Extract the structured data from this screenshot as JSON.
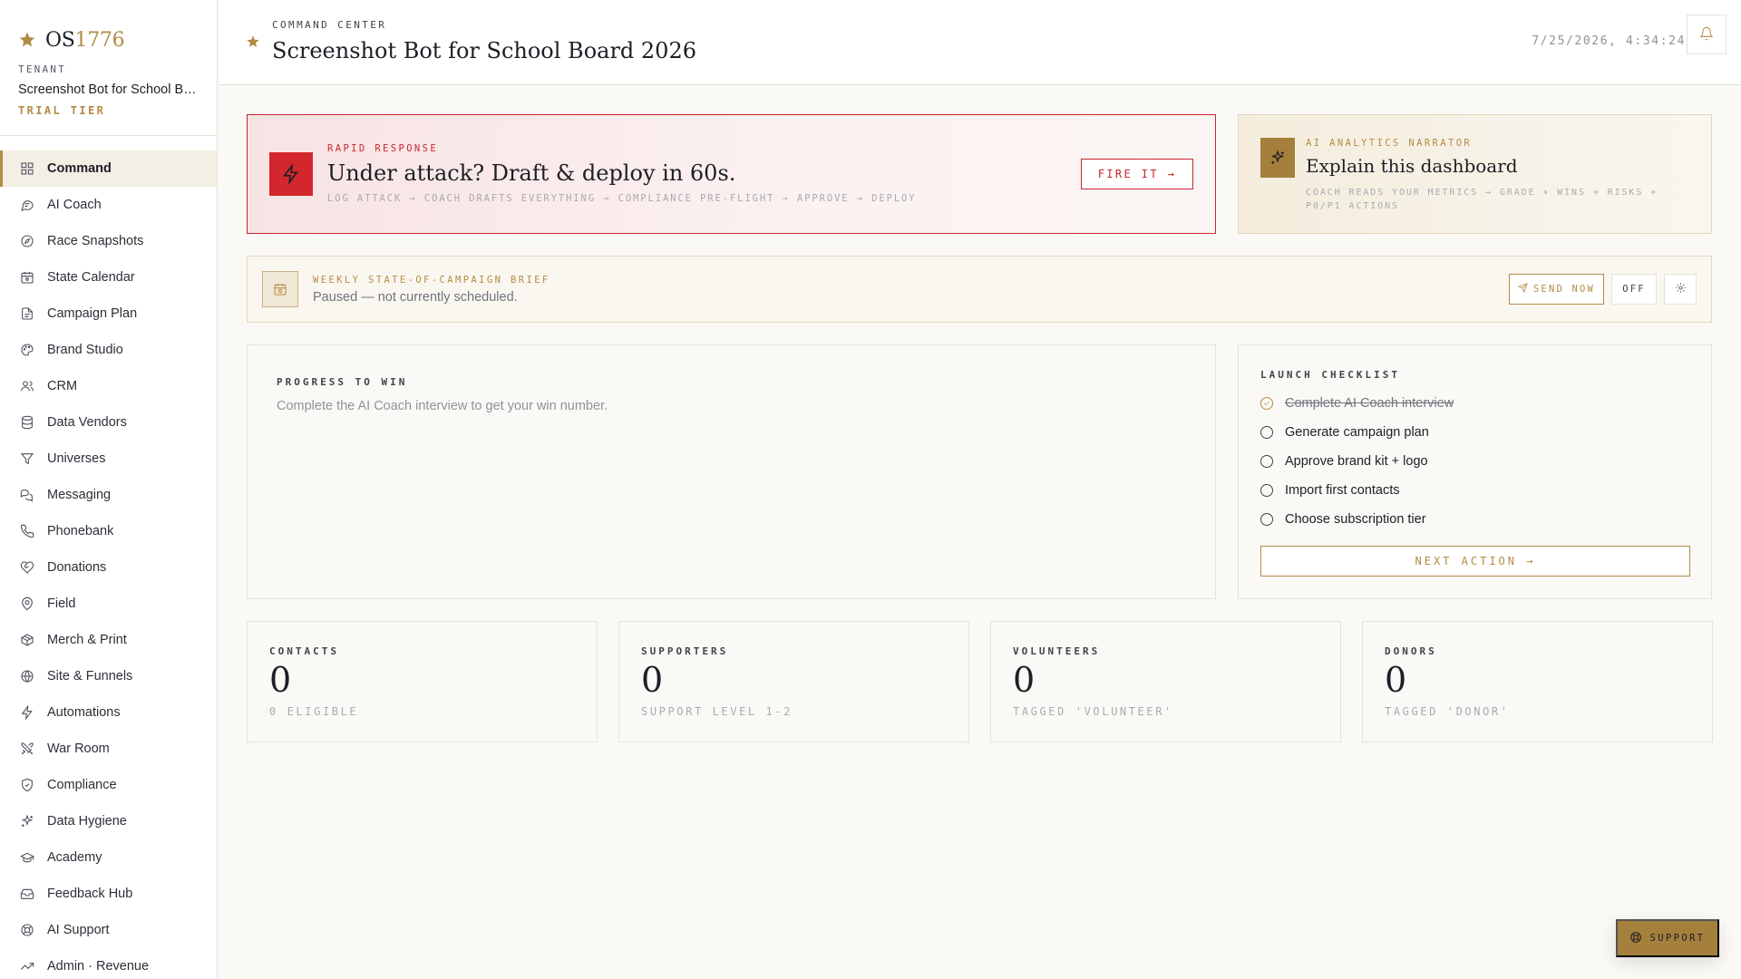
{
  "brand": {
    "name_part1": "OS",
    "name_part2": "1776"
  },
  "tenant": {
    "label": "TENANT",
    "name": "Screenshot Bot for School Board 2026",
    "tier": "TRIAL TIER"
  },
  "nav": [
    {
      "label": "Command",
      "icon": "grid-icon",
      "active": true
    },
    {
      "label": "AI Coach",
      "icon": "chat-icon"
    },
    {
      "label": "Race Snapshots",
      "icon": "compass-icon"
    },
    {
      "label": "State Calendar",
      "icon": "calendar-icon"
    },
    {
      "label": "Campaign Plan",
      "icon": "document-icon"
    },
    {
      "label": "Brand Studio",
      "icon": "palette-icon"
    },
    {
      "label": "CRM",
      "icon": "users-icon"
    },
    {
      "label": "Data Vendors",
      "icon": "database-icon"
    },
    {
      "label": "Universes",
      "icon": "filter-icon"
    },
    {
      "label": "Messaging",
      "icon": "messages-icon"
    },
    {
      "label": "Phonebank",
      "icon": "phone-icon"
    },
    {
      "label": "Donations",
      "icon": "heart-hand-icon"
    },
    {
      "label": "Field",
      "icon": "map-pin-icon"
    },
    {
      "label": "Merch & Print",
      "icon": "package-icon"
    },
    {
      "label": "Site & Funnels",
      "icon": "globe-icon"
    },
    {
      "label": "Automations",
      "icon": "bolt-icon"
    },
    {
      "label": "War Room",
      "icon": "swords-icon"
    },
    {
      "label": "Compliance",
      "icon": "shield-check-icon"
    },
    {
      "label": "Data Hygiene",
      "icon": "sparkles-icon"
    },
    {
      "label": "Academy",
      "icon": "graduation-cap-icon"
    },
    {
      "label": "Feedback Hub",
      "icon": "inbox-icon"
    },
    {
      "label": "AI Support",
      "icon": "life-buoy-icon"
    },
    {
      "label": "Admin · Revenue",
      "icon": "trending-up-icon"
    }
  ],
  "header": {
    "label": "COMMAND CENTER",
    "title": "Screenshot Bot for School Board 2026",
    "clock": "7/25/2026, 4:34:24"
  },
  "rapid": {
    "label": "RAPID RESPONSE",
    "title": "Under attack? Draft & deploy in 60s.",
    "subtitle": "LOG ATTACK → COACH DRAFTS EVERYTHING → COMPLIANCE PRE-FLIGHT → APPROVE → DEPLOY",
    "button": "FIRE IT →"
  },
  "narrator": {
    "label": "AI ANALYTICS NARRATOR",
    "title": "Explain this dashboard",
    "subtitle": "COACH READS YOUR METRICS → GRADE + WINS + RISKS + P0/P1 ACTIONS"
  },
  "weekly": {
    "label": "WEEKLY STATE-OF-CAMPAIGN BRIEF",
    "status": "Paused — not currently scheduled.",
    "send_button": "SEND NOW",
    "toggle_button": "OFF"
  },
  "progress": {
    "label": "PROGRESS TO WIN",
    "text": "Complete the AI Coach interview to get your win number."
  },
  "checklist": {
    "label": "LAUNCH CHECKLIST",
    "items": [
      {
        "label": "Complete AI Coach interview",
        "done": true
      },
      {
        "label": "Generate campaign plan",
        "done": false
      },
      {
        "label": "Approve brand kit + logo",
        "done": false
      },
      {
        "label": "Import first contacts",
        "done": false
      },
      {
        "label": "Choose subscription tier",
        "done": false
      }
    ],
    "next_button": "NEXT ACTION →"
  },
  "stats": [
    {
      "label": "CONTACTS",
      "value": "0",
      "sub": "0 ELIGIBLE"
    },
    {
      "label": "SUPPORTERS",
      "value": "0",
      "sub": "SUPPORT LEVEL 1-2"
    },
    {
      "label": "VOLUNTEERS",
      "value": "0",
      "sub": "TAGGED 'VOLUNTEER'"
    },
    {
      "label": "DONORS",
      "value": "0",
      "sub": "TAGGED 'DONOR'"
    }
  ],
  "support_button": "SUPPORT",
  "colors": {
    "accent": "#b48b45",
    "danger": "#c8262c",
    "ink": "#1c1f26"
  }
}
